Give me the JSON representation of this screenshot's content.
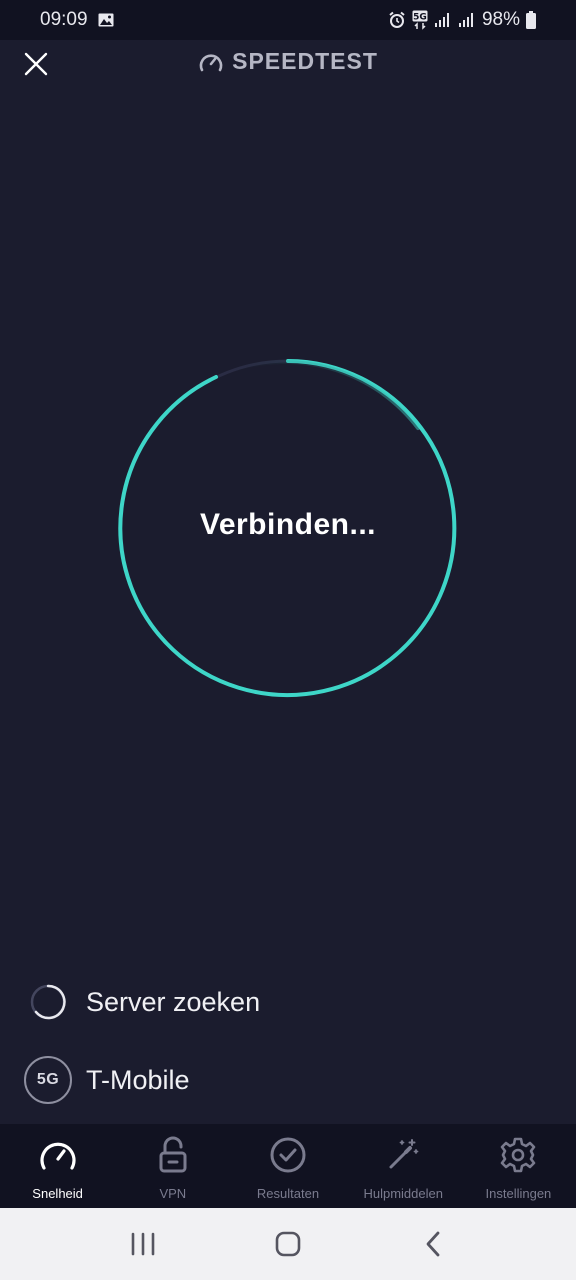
{
  "status_bar": {
    "time": "09:09",
    "network_badge": "5G",
    "battery": "98%"
  },
  "header": {
    "brand": "SPEEDTEST"
  },
  "gauge": {
    "status_text": "Verbinden...",
    "accent_color": "#3ed6c8"
  },
  "server_row": {
    "label": "Server zoeken"
  },
  "provider_row": {
    "badge": "5G",
    "label": "T-Mobile"
  },
  "bottom_nav": {
    "items": [
      {
        "label": "Snelheid",
        "icon": "speedometer-icon",
        "active": true
      },
      {
        "label": "VPN",
        "icon": "unlock-icon",
        "active": false
      },
      {
        "label": "Resultaten",
        "icon": "check-circle-icon",
        "active": false
      },
      {
        "label": "Hulpmiddelen",
        "icon": "magic-wand-icon",
        "active": false
      },
      {
        "label": "Instellingen",
        "icon": "gear-icon",
        "active": false
      }
    ]
  },
  "system_nav": {
    "recents_icon": "recents-icon",
    "home_icon": "home-icon",
    "back_icon": "back-icon"
  }
}
